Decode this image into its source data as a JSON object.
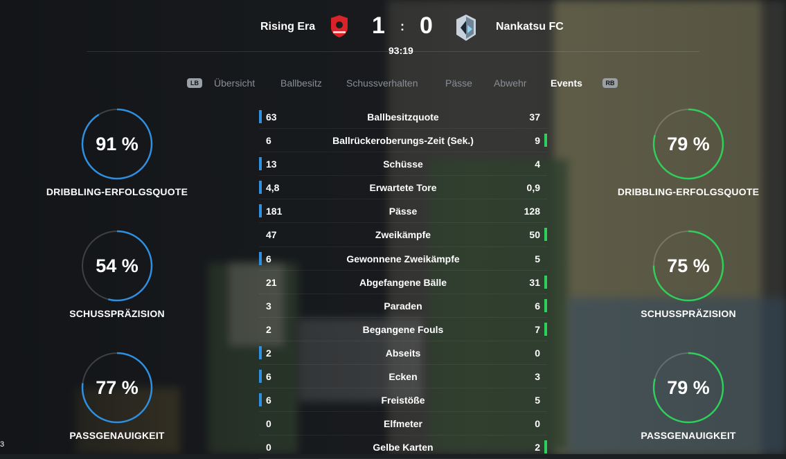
{
  "match": {
    "home_team": "Rising Era",
    "away_team": "Nankatsu FC",
    "home_score": "1",
    "separator": ":",
    "away_score": "0",
    "clock": "93:19",
    "home_color": "#d8232a",
    "away_color": "#9fb3c8"
  },
  "tabs": {
    "left_bumper": "LB",
    "right_bumper": "RB",
    "items": [
      {
        "label": "Übersicht",
        "active": false
      },
      {
        "label": "Ballbesitz",
        "active": false
      },
      {
        "label": "Schussverhalten",
        "active": false
      },
      {
        "label": "Pässe",
        "active": false
      },
      {
        "label": "Abwehr",
        "active": false
      },
      {
        "label": "Events",
        "active": true
      }
    ]
  },
  "colors": {
    "home_accent": "#2f8fe0",
    "away_accent": "#2ecf5b"
  },
  "home_rings": [
    {
      "value": "91 %",
      "pct": 91,
      "label": "DRIBBLING-ERFOLGSQUOTE"
    },
    {
      "value": "54 %",
      "pct": 54,
      "label": "SCHUSSPRÄZISION"
    },
    {
      "value": "77 %",
      "pct": 77,
      "label": "PASSGENAUIGKEIT"
    }
  ],
  "away_rings": [
    {
      "value": "79 %",
      "pct": 79,
      "label": "DRIBBLING-ERFOLGSQUOTE"
    },
    {
      "value": "75 %",
      "pct": 75,
      "label": "SCHUSSPRÄZISION"
    },
    {
      "value": "79 %",
      "pct": 79,
      "label": "PASSGENAUIGKEIT"
    }
  ],
  "stats": [
    {
      "label": "Ballbesitzquote",
      "home": "63",
      "away": "37",
      "leader": "home"
    },
    {
      "label": "Ballrückeroberungs-Zeit (Sek.)",
      "home": "6",
      "away": "9",
      "leader": "away"
    },
    {
      "label": "Schüsse",
      "home": "13",
      "away": "4",
      "leader": "home"
    },
    {
      "label": "Erwartete Tore",
      "home": "4,8",
      "away": "0,9",
      "leader": "home"
    },
    {
      "label": "Pässe",
      "home": "181",
      "away": "128",
      "leader": "home"
    },
    {
      "label": "Zweikämpfe",
      "home": "47",
      "away": "50",
      "leader": "away"
    },
    {
      "label": "Gewonnene Zweikämpfe",
      "home": "6",
      "away": "5",
      "leader": "home"
    },
    {
      "label": "Abgefangene Bälle",
      "home": "21",
      "away": "31",
      "leader": "away"
    },
    {
      "label": "Paraden",
      "home": "3",
      "away": "6",
      "leader": "away"
    },
    {
      "label": "Begangene Fouls",
      "home": "2",
      "away": "7",
      "leader": "away"
    },
    {
      "label": "Abseits",
      "home": "2",
      "away": "0",
      "leader": "home"
    },
    {
      "label": "Ecken",
      "home": "6",
      "away": "3",
      "leader": "home"
    },
    {
      "label": "Freistöße",
      "home": "6",
      "away": "5",
      "leader": "home"
    },
    {
      "label": "Elfmeter",
      "home": "0",
      "away": "0",
      "leader": "none"
    },
    {
      "label": "Gelbe Karten",
      "home": "0",
      "away": "2",
      "leader": "away"
    }
  ],
  "corner_text": "3"
}
